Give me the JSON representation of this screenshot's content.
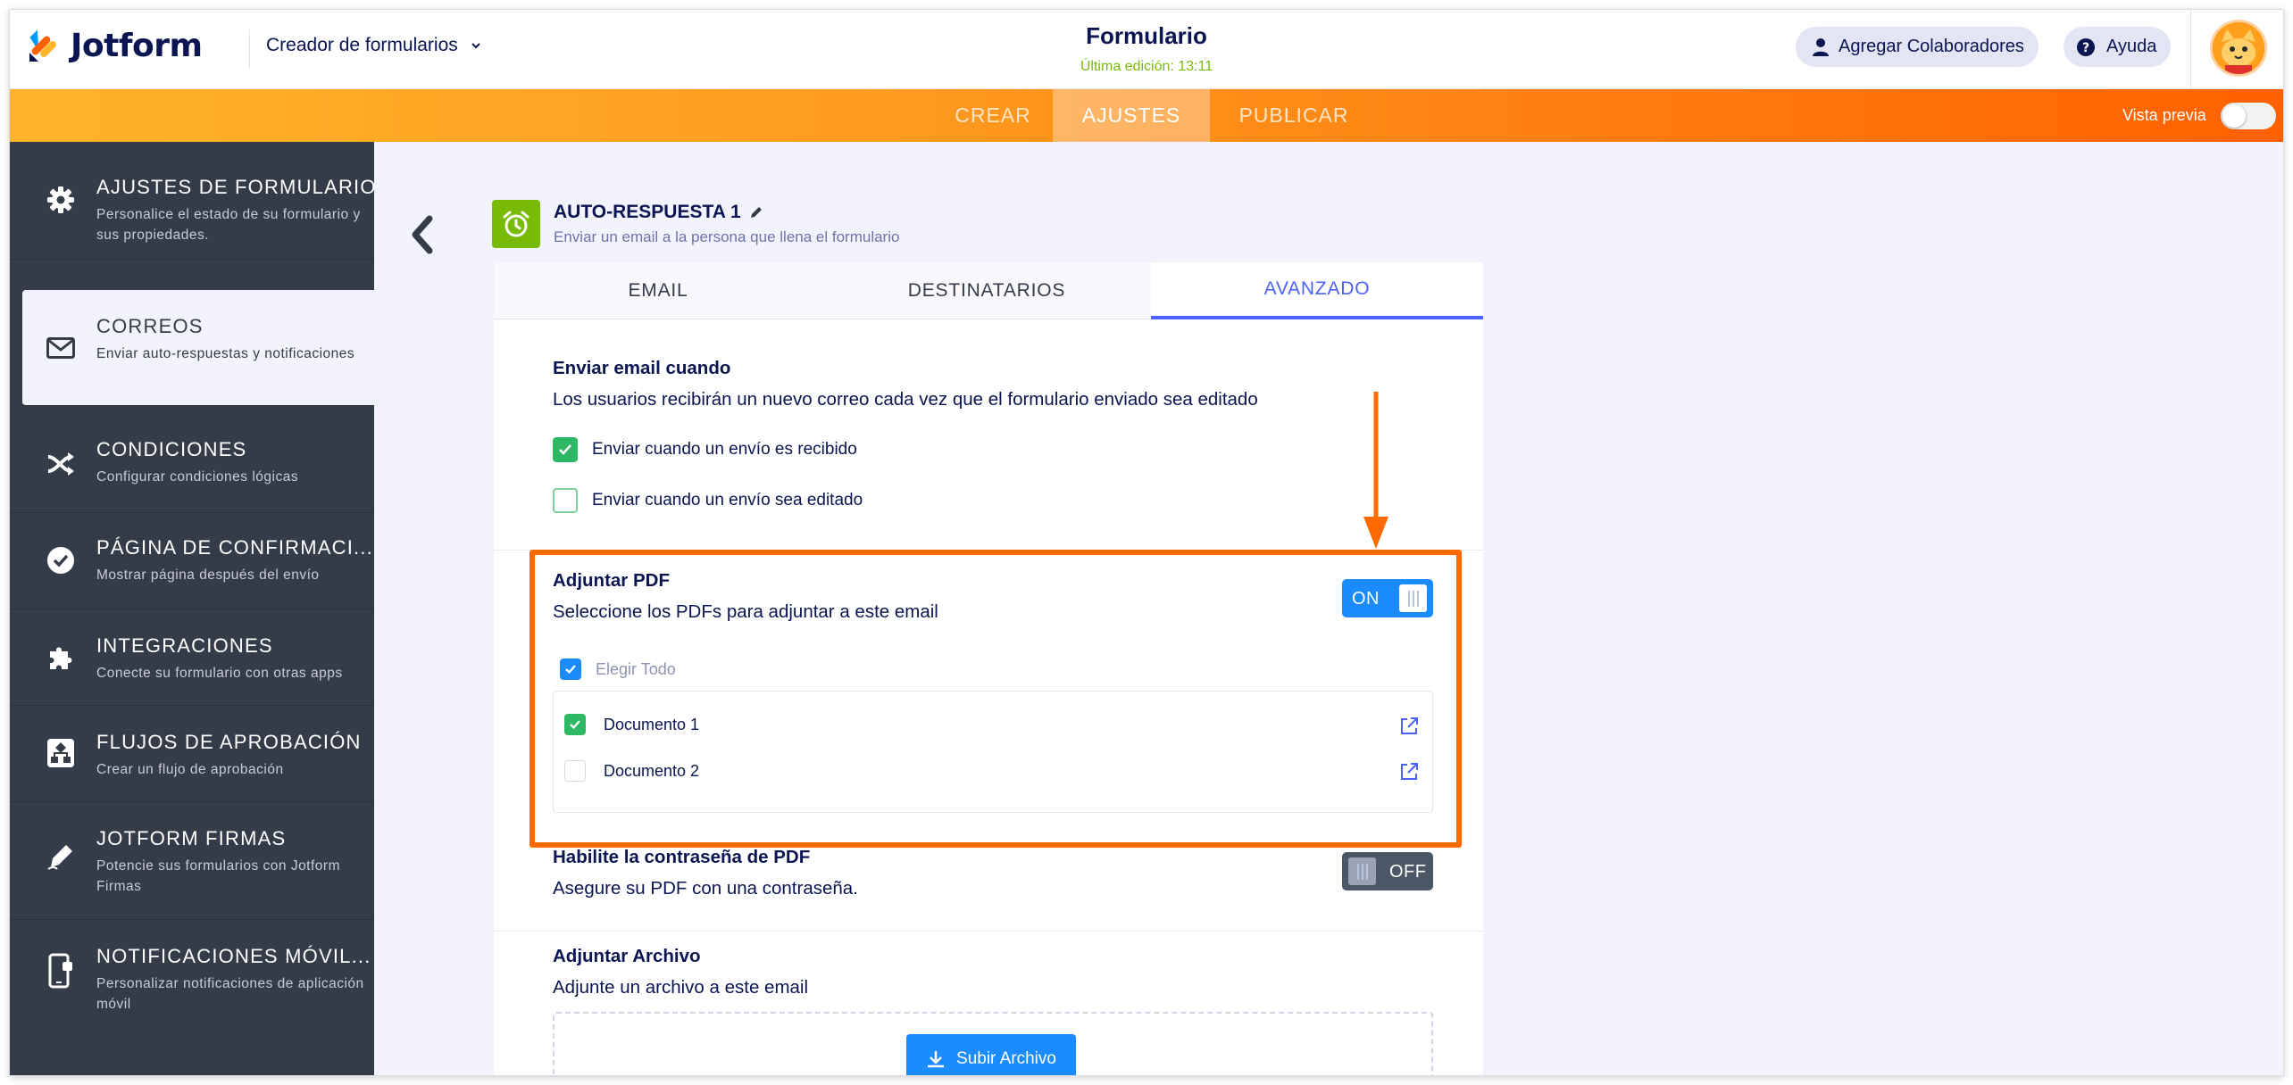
{
  "header": {
    "logo_text": "Jotform",
    "form_builder_label": "Creador de formularios",
    "form_title": "Formulario",
    "last_edit": "Última edición: 13:11",
    "add_collaborators": "Agregar Colaboradores",
    "help": "Ayuda"
  },
  "navbar": {
    "tabs": [
      "CREAR",
      "AJUSTES",
      "PUBLICAR"
    ],
    "active_tab": "AJUSTES",
    "preview_label": "Vista previa",
    "preview_enabled": false,
    "accent_start": "#ffb329",
    "accent_end": "#ff6100"
  },
  "sidebar": {
    "items": [
      {
        "title": "AJUSTES DE FORMULARIO",
        "desc": "Personalice el estado de su formulario y sus propiedades.",
        "icon": "gear-icon"
      },
      {
        "title": "CORREOS",
        "desc": "Enviar auto-respuestas y notificaciones",
        "icon": "envelope-icon",
        "active": true
      },
      {
        "title": "CONDICIONES",
        "desc": "Configurar condiciones lógicas",
        "icon": "shuffle-icon"
      },
      {
        "title": "PÁGINA DE CONFIRMACI...",
        "desc": "Mostrar página después del envío",
        "icon": "check-circle-icon"
      },
      {
        "title": "INTEGRACIONES",
        "desc": "Conecte su formulario con otras apps",
        "icon": "puzzle-icon"
      },
      {
        "title": "FLUJOS DE APROBACIÓN",
        "desc": "Crear un flujo de aprobación",
        "icon": "flow-icon"
      },
      {
        "title": "JOTFORM FIRMAS",
        "desc": "Potencie sus formularios con Jotform Firmas",
        "icon": "pen-icon"
      },
      {
        "title": "NOTIFICACIONES MÓVIL...",
        "desc": "Personalizar notificaciones de aplicación móvil",
        "icon": "mobile-icon"
      }
    ]
  },
  "autoresponse": {
    "title": "AUTO-RESPUESTA 1",
    "subtitle": "Enviar un email a la persona que llena el formulario"
  },
  "panel_tabs": {
    "email": "EMAIL",
    "recipients": "DESTINATARIOS",
    "advanced": "AVANZADO",
    "active": "AVANZADO"
  },
  "send_when": {
    "title": "Enviar email cuando",
    "desc": "Los usuarios recibirán un nuevo correo cada vez que el formulario enviado sea editado",
    "options": [
      {
        "label": "Enviar cuando un envío es recibido",
        "checked": true
      },
      {
        "label": "Enviar cuando un envío sea editado",
        "checked": false
      }
    ]
  },
  "attach_pdf": {
    "title": "Adjuntar PDF",
    "desc": "Seleccione los PDFs para adjuntar a este email",
    "toggle": "ON",
    "select_all": "Elegir Todo",
    "select_all_checked": true,
    "documents": [
      {
        "name": "Documento 1",
        "checked": true
      },
      {
        "name": "Documento 2",
        "checked": false
      }
    ]
  },
  "pdf_password": {
    "title": "Habilite la contraseña de PDF",
    "desc": "Asegure su PDF con una contraseña.",
    "toggle": "OFF"
  },
  "attach_file": {
    "title": "Adjuntar Archivo",
    "desc": "Adjunte un archivo a este email",
    "upload_label": "Subir Archivo"
  },
  "annotation": {
    "highlight_color": "#ff6a00"
  }
}
